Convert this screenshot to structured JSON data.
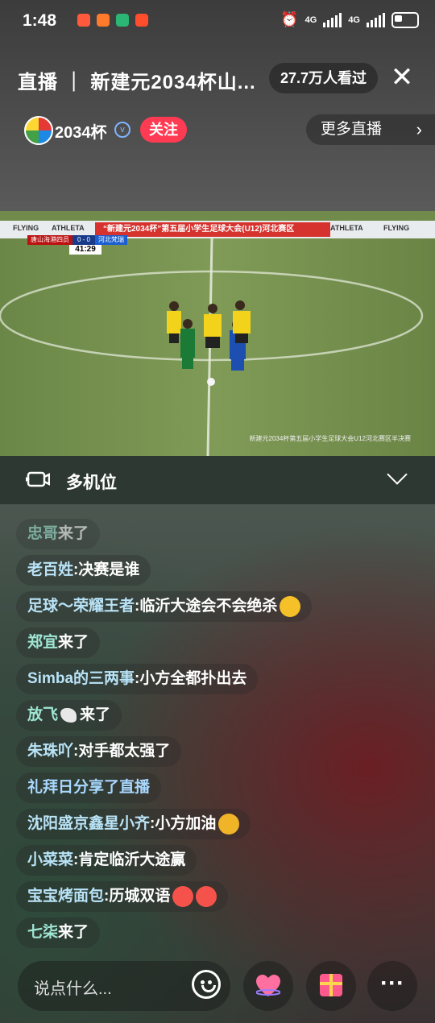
{
  "status_bar": {
    "time": "1:48",
    "network_1": "4G",
    "network_2": "4G"
  },
  "header": {
    "title": "直播 ｜ 新建元2034杯山...",
    "viewers": "27.7万人看过",
    "close_icon": "close-icon"
  },
  "host": {
    "name": "2034杯",
    "follow_label": "关注",
    "more_live_label": "更多直播"
  },
  "video": {
    "banner_text": "“新建元2034杯”第五届小学生足球大会(U12)河北赛区",
    "sponsor_left": "FLYING",
    "sponsor_athleta": "ATHLETA",
    "sponsor_right": "FLYING",
    "team_home": "唐山海港四员",
    "score": "0 - 0",
    "team_away": "河北梵瑞",
    "match_clock": "41:29",
    "caption": "新建元2034杯第五届小学生足球大会U12河北赛区半决赛"
  },
  "multicam": {
    "label": "多机位"
  },
  "chat": [
    {
      "user": "忠哥",
      "sep": " ",
      "text": "来了"
    },
    {
      "user": "老百姓",
      "sep": ": ",
      "text": "决赛是谁"
    },
    {
      "user": "足球～荣耀王者",
      "sep": ": ",
      "text": "临沂大途会不会绝杀"
    },
    {
      "user": "郑宜",
      "sep": " ",
      "text": "来了"
    },
    {
      "user": "Simba的三两事",
      "sep": ": ",
      "text": "小方全都扑出去"
    },
    {
      "user": "放飞",
      "sep": " ",
      "text": "来了"
    },
    {
      "user": "朱珠吖",
      "sep": ": ",
      "text": "对手都太强了"
    },
    {
      "user": "礼拜日",
      "sep": " ",
      "text": "分享了直播"
    },
    {
      "user": "沈阳盛京鑫星小齐",
      "sep": ": ",
      "text": "小方加油"
    },
    {
      "user": "小菜菜",
      "sep": ": ",
      "text": "肯定临沂大途赢"
    },
    {
      "user": "宝宝烤面包",
      "sep": ": ",
      "text": "历城双语"
    },
    {
      "user": "七柒",
      "sep": " ",
      "text": "来了"
    }
  ],
  "bottom_bar": {
    "input_placeholder": "说点什么..."
  },
  "colors": {
    "follow": "#ff3b54",
    "username": "#b9e3f7"
  }
}
